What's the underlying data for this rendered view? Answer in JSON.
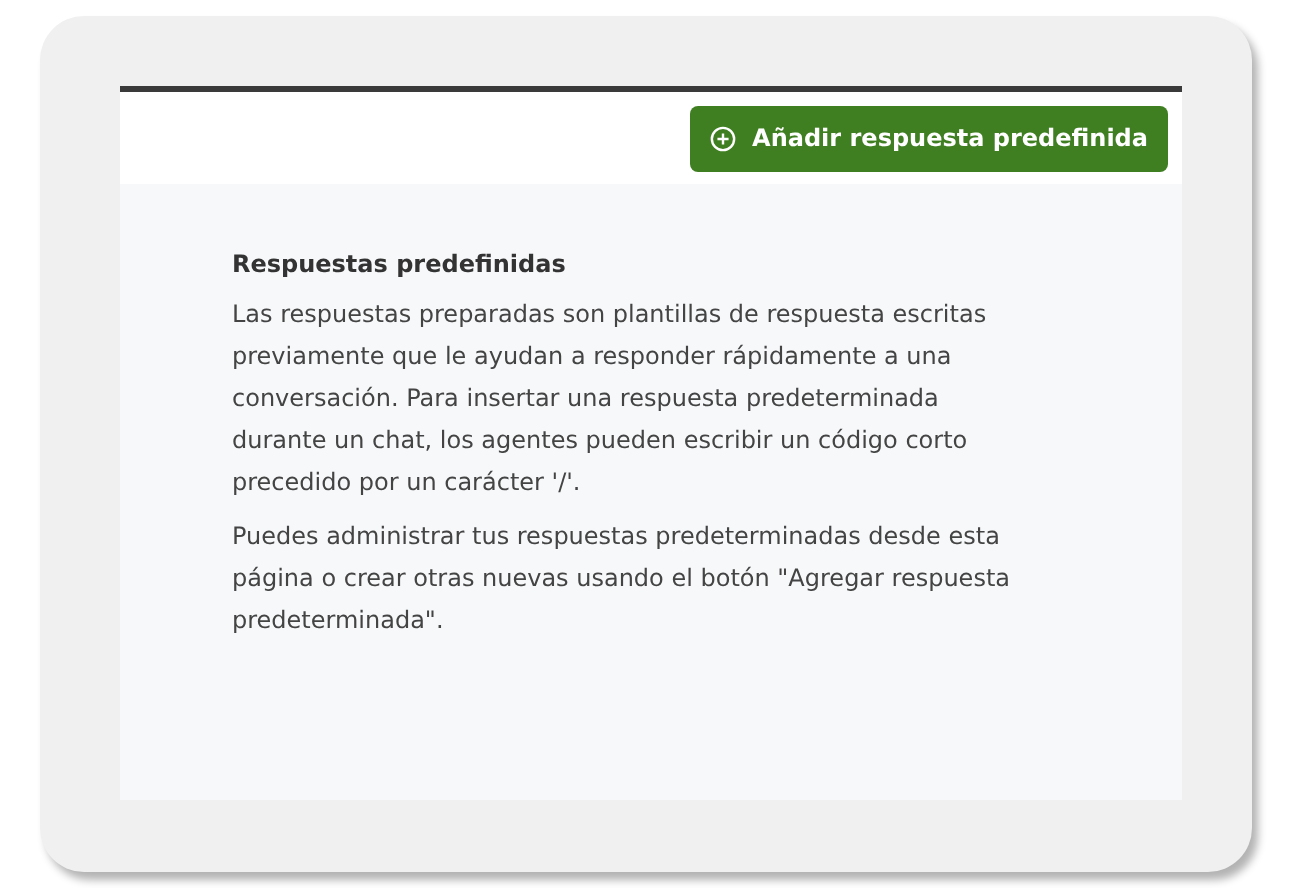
{
  "header": {
    "button": "Añadir respuesta predefinida"
  },
  "content": {
    "title": "Respuestas predefinidas",
    "paragraphs": [
      "Las respuestas preparadas son plantillas de respuesta escritas previamente que le ayudan a responder rápidamente a una conversación. Para insertar una respuesta predeterminada durante un chat, los agentes pueden escribir un código corto precedido por un carácter '/'.",
      "Puedes administrar tus respuestas predeterminadas desde esta página o crear otras nuevas usando el botón \"Agregar respuesta predeterminada\"."
    ]
  }
}
